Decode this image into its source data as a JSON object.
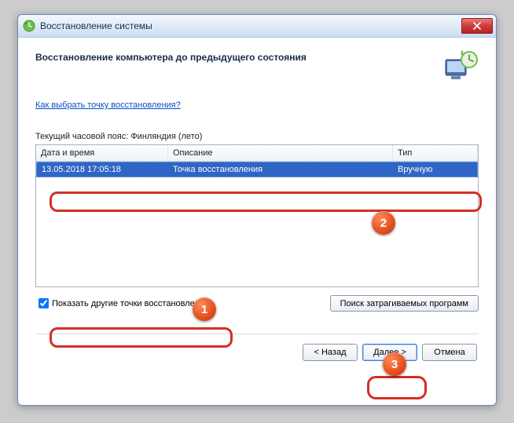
{
  "titlebar": {
    "title": "Восстановление системы"
  },
  "header": {
    "heading": "Восстановление компьютера до предыдущего состояния"
  },
  "help": {
    "link_label": "Как выбрать точку восстановления?"
  },
  "timezone": {
    "label": "Текущий часовой пояс: Финляндия (лето)"
  },
  "grid": {
    "headers": {
      "date": "Дата и время",
      "desc": "Описание",
      "type": "Тип"
    },
    "rows": [
      {
        "date": "13.05.2018 17:05:18",
        "desc": "Точка восстановления",
        "type": "Вручную"
      }
    ]
  },
  "options": {
    "show_other_label": "Показать другие точки восстановления",
    "search_affected_label": "Поиск затрагиваемых программ"
  },
  "wizard": {
    "back": "< Назад",
    "next": "Далее >",
    "cancel": "Отмена"
  },
  "annotations": {
    "b1": "1",
    "b2": "2",
    "b3": "3"
  }
}
